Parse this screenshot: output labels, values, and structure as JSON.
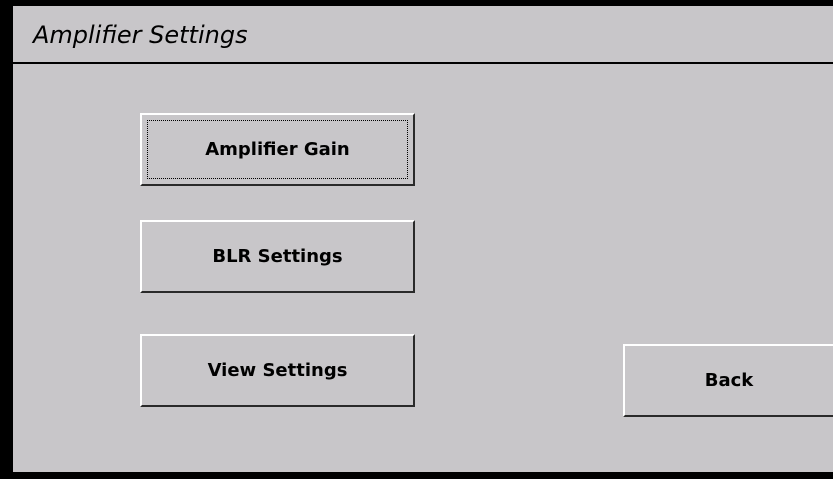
{
  "window": {
    "title": "Amplifier Settings"
  },
  "buttons": {
    "amplifier_gain": "Amplifier Gain",
    "blr_settings": "BLR Settings",
    "view_settings": "View Settings",
    "back": "Back"
  },
  "colors": {
    "panel_background": "#c8c6c9",
    "outer_background": "#000000",
    "text": "#000000"
  }
}
